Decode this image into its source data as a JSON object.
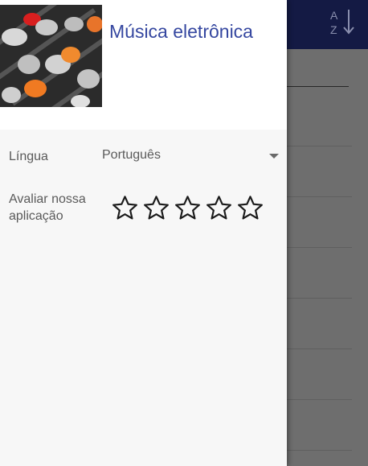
{
  "drawer": {
    "title": "Música eletrônica",
    "language_label": "Língua",
    "language_value": "Português",
    "rating_label": "Avaliar nossa aplicação",
    "rating": {
      "value": 0,
      "max": 5
    }
  },
  "app_bar": {
    "sort_icon": "sort-alpha-icon"
  },
  "colors": {
    "app_bar": "#141a44",
    "accent_title": "#3547a0",
    "drawer_bg": "#f7f7f7",
    "scrim": "#6e6e6e"
  }
}
